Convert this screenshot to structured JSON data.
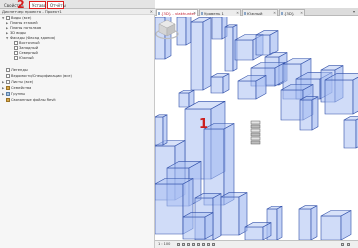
{
  "left_panel": {
    "tabs": [
      {
        "label": "Свойства"
      },
      {
        "label": "Уставс"
      },
      {
        "label": "Отчёты"
      }
    ],
    "header_title": "Диспетчер проекта - Проект1",
    "tree": [
      {
        "label": "Виды (все)"
      },
      {
        "label": "Планы этажей"
      },
      {
        "label": "Планы потолков"
      },
      {
        "label": "3D виды"
      },
      {
        "label": "Фасады (Фасад здания)"
      },
      {
        "label": "Восточный"
      },
      {
        "label": "Западный"
      },
      {
        "label": "Северный"
      },
      {
        "label": "Южный"
      },
      {
        "label": "Легенды"
      },
      {
        "label": "Ведомости/Спецификации (все)"
      },
      {
        "label": "Листы (все)"
      },
      {
        "label": "Семейства"
      },
      {
        "label": "Группы"
      },
      {
        "label": "Связанные файлы Revit"
      }
    ]
  },
  "annotations": {
    "marker_1": "1",
    "marker_2": "2"
  },
  "document_tabs": [
    {
      "label": "{3D} - vlakhunter"
    },
    {
      "label": "Уровень 1"
    },
    {
      "label": "Южный"
    },
    {
      "label": "{3D}"
    }
  ],
  "view_bar": {
    "scale": "1 : 100"
  },
  "colors": {
    "accent_red": "#e01e1e",
    "box_fill": "#a9bff2",
    "box_stroke": "#2f4ea8"
  },
  "icons": {
    "view_cube": "view-cube-icon",
    "close": "close-icon",
    "expand": "chevron-right-icon"
  }
}
